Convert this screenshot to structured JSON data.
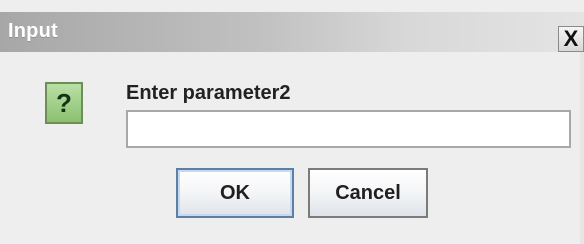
{
  "window": {
    "title": "Input",
    "close_label": "X"
  },
  "dialog": {
    "icon": "question-icon",
    "icon_glyph": "?",
    "prompt": "Enter parameter2",
    "input_value": ""
  },
  "buttons": {
    "ok_label": "OK",
    "cancel_label": "Cancel"
  },
  "colors": {
    "titlebar_start": "#a7a7a7",
    "titlebar_end": "#e4e4e4",
    "icon_bg": "#8cc170",
    "dialog_bg": "#eeeeee"
  }
}
